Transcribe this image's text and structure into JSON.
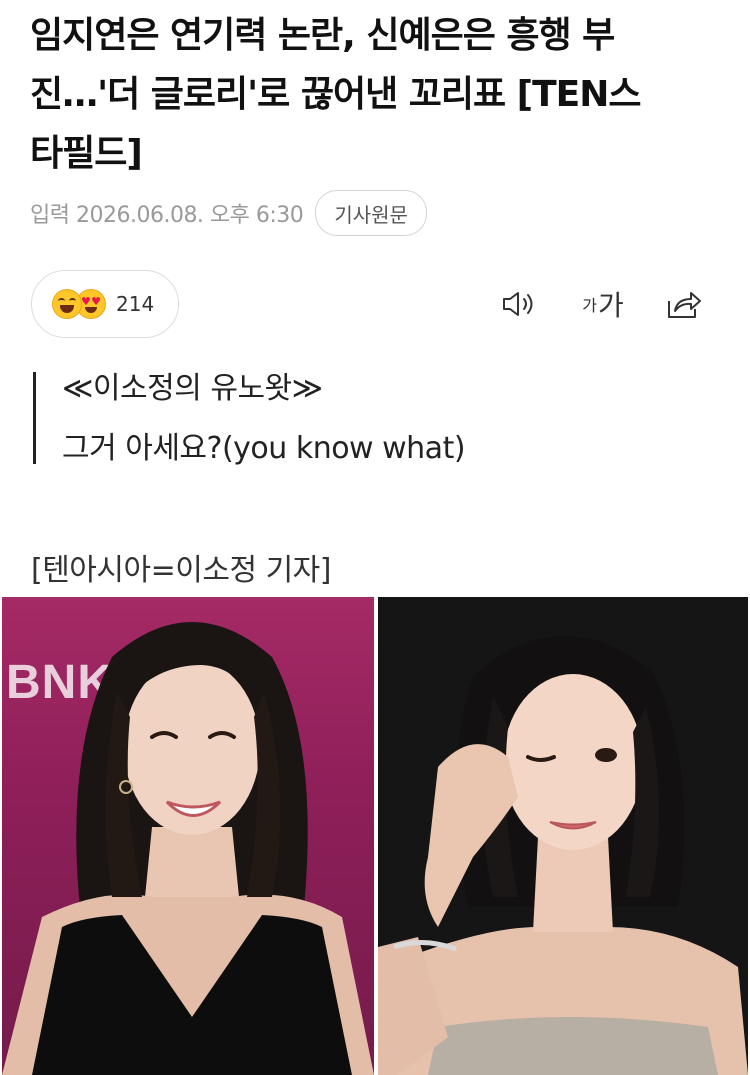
{
  "article": {
    "headline_lines": [
      "임지연은 연기력 논란, 신예은은 흥행 부",
      "진…'더 글로리'로 끊어낸 꼬리표 [TEN스",
      "타필드]"
    ],
    "date": "입력 2026.06.08. 오후 6:30",
    "original_button": "기사원문"
  },
  "toolbar": {
    "reaction_count": "214",
    "font_small": "가",
    "font_big": "가"
  },
  "quote": {
    "line1": "≪이소정의 유노왓≫",
    "line2": "그거 아세요?(you know what)"
  },
  "byline": "[텐아시아=이소정 기자]",
  "photos": {
    "left_banner_text": "BNK"
  }
}
